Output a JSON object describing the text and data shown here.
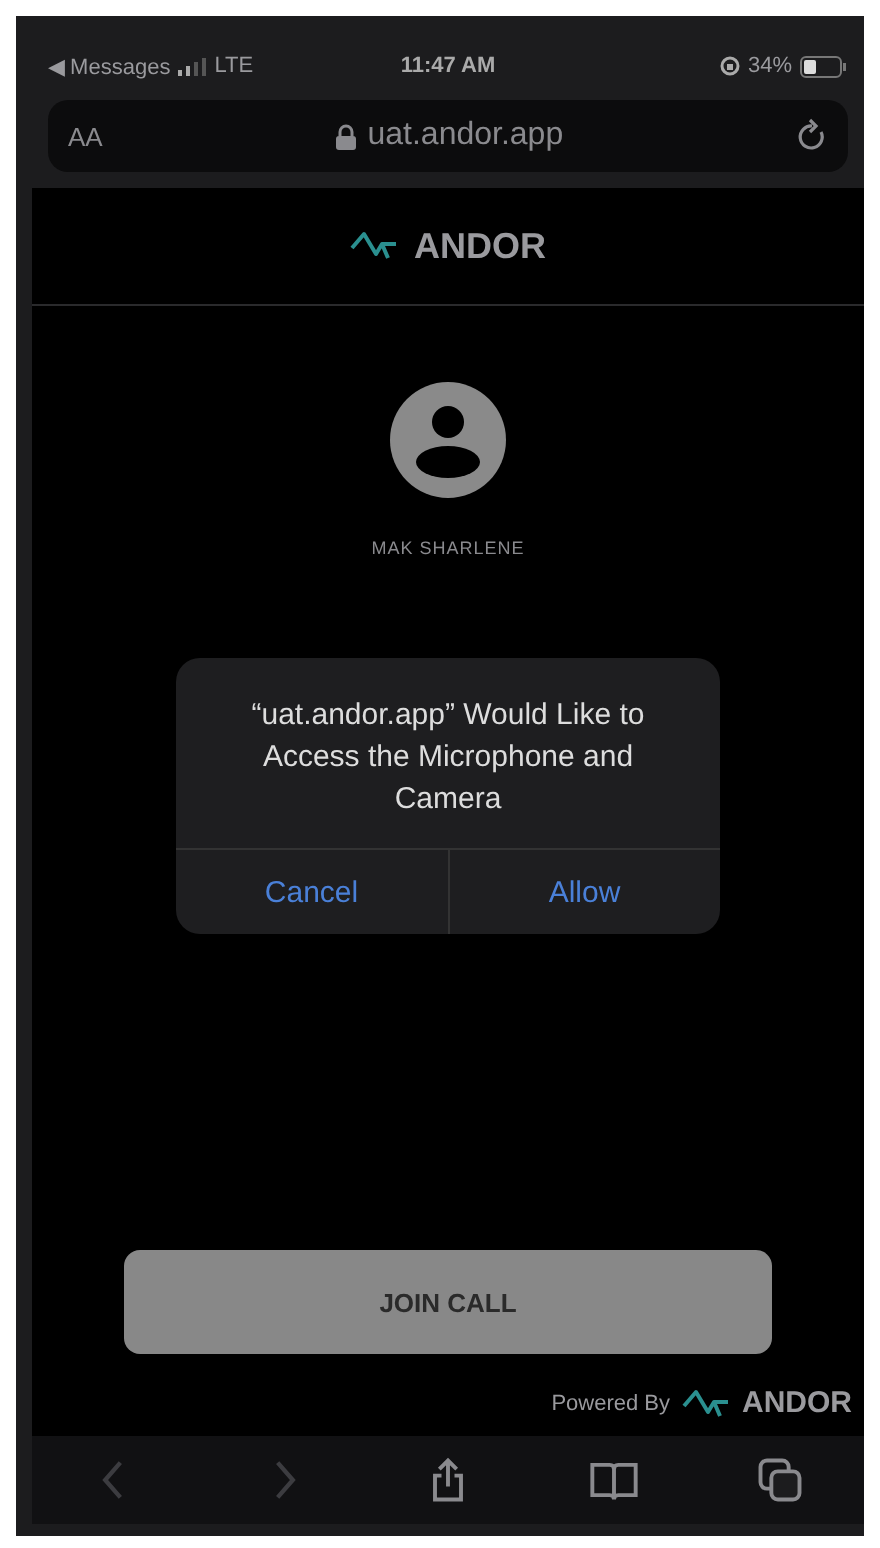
{
  "status_bar": {
    "back_label": "◀ Messages",
    "network": "LTE",
    "time": "11:47 AM",
    "battery": "34%"
  },
  "address_bar": {
    "text_size": "AA",
    "url": "uat.andor.app"
  },
  "header": {
    "brand": "ANDOR"
  },
  "profile": {
    "name": "MAK SHARLENE"
  },
  "alert": {
    "message": "“uat.andor.app” Would Like to Access the Microphone and Camera",
    "buttons": [
      {
        "label": "Cancel",
        "bold": false
      },
      {
        "label": "Allow",
        "bold": false
      }
    ]
  },
  "join_button": {
    "label": "JOIN CALL",
    "disabled": true
  },
  "footer": {
    "powered_by": "Powered By",
    "brand": "ANDOR"
  },
  "toolbar": [
    {
      "kind": "back",
      "disabled": true
    },
    {
      "kind": "forward",
      "disabled": true
    },
    {
      "kind": "share",
      "disabled": false
    },
    {
      "kind": "bookmarks",
      "disabled": false
    },
    {
      "kind": "tabs",
      "disabled": false
    }
  ]
}
